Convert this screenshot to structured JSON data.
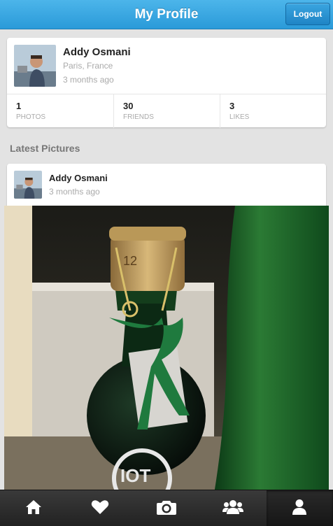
{
  "header": {
    "title": "My Profile",
    "logout_label": "Logout"
  },
  "profile": {
    "name": "Addy Osmani",
    "location": "Paris, France",
    "joined": "3 months ago",
    "stats": [
      {
        "value": "1",
        "label": "PHOTOS"
      },
      {
        "value": "30",
        "label": "FRIENDS"
      },
      {
        "value": "3",
        "label": "LIKES"
      }
    ]
  },
  "section_title": "Latest Pictures",
  "post": {
    "author": "Addy Osmani",
    "time": "3 months ago"
  },
  "tabbar": {
    "active_index": 4,
    "items": [
      {
        "icon": "home-icon"
      },
      {
        "icon": "heart-icon"
      },
      {
        "icon": "camera-icon"
      },
      {
        "icon": "users-icon"
      },
      {
        "icon": "user-icon"
      }
    ]
  },
  "colors": {
    "header_blue": "#2a9ad9",
    "tabbar_dark": "#222222",
    "background": "#e3e3e3"
  }
}
